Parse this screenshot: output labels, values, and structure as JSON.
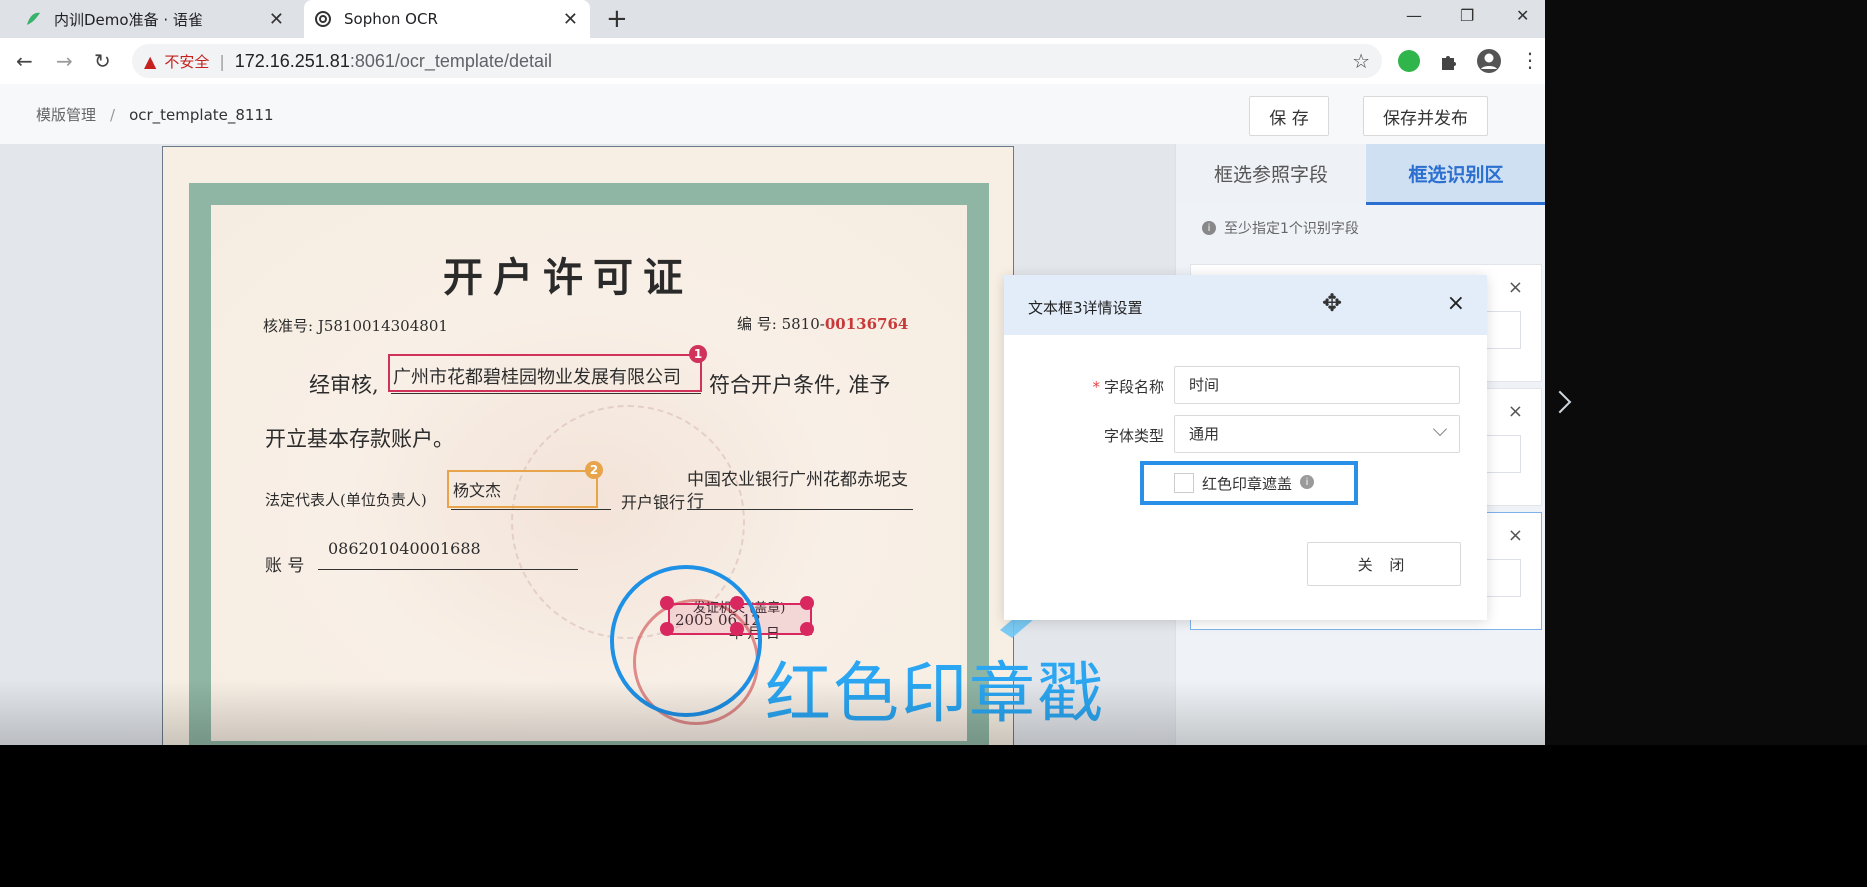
{
  "browser": {
    "tabs": [
      {
        "title": "内训Demo准备 · 语雀"
      },
      {
        "title": "Sophon OCR"
      }
    ],
    "new_tab": "+",
    "security_label": "不安全",
    "url_host": "172.16.251.81",
    "url_rest": ":8061/ocr_template/detail"
  },
  "header": {
    "breadcrumb_root": "模版管理",
    "breadcrumb_sep": "/",
    "breadcrumb_current": "ocr_template_8111",
    "save_label": "保 存",
    "save_publish_label": "保存并发布"
  },
  "certificate": {
    "title": "开户许可证",
    "approval_no": "核准号: J5810014304801",
    "serial_prefix": "编 号: 5810-",
    "serial_red": "00136764",
    "line1_prefix": "经审核,",
    "company": "广州市花都碧桂园物业发展有限公司",
    "line1_suffix": "符合开户条件, 准予",
    "line2": "开立基本存款账户。",
    "legal_label": "法定代表人(单位负责人)",
    "legal_name": "杨文杰",
    "bank_label": "开户银行",
    "bank_name_1": "中国农业银行广州花都赤坭支",
    "bank_name_2": "行",
    "account_label": "账  号",
    "account_no": "086201040001688",
    "issue_label": "发证机关 (盖章)",
    "issue_date": "2005  06  12",
    "date_units": "年   月   日",
    "box1_badge": "1",
    "box2_badge": "2"
  },
  "annotation": {
    "caption": "红色印章戳"
  },
  "right_panel": {
    "tab_reference": "框选参照字段",
    "tab_recognition": "框选识别区",
    "tip": "至少指定1个识别字段",
    "card_close": "×"
  },
  "dialog": {
    "title": "文本框3详情设置",
    "close": "×",
    "field_name_label": "字段名称",
    "field_name_value": "时间",
    "font_type_label": "字体类型",
    "font_type_value": "通用",
    "red_stamp_label": "红色印章遮盖",
    "close_button": "关 闭"
  },
  "colors": {
    "accent": "#2b6fd1",
    "annotation_blue": "#2aa6f2",
    "box_red": "#d0325a",
    "box_orange": "#e7a44a"
  }
}
